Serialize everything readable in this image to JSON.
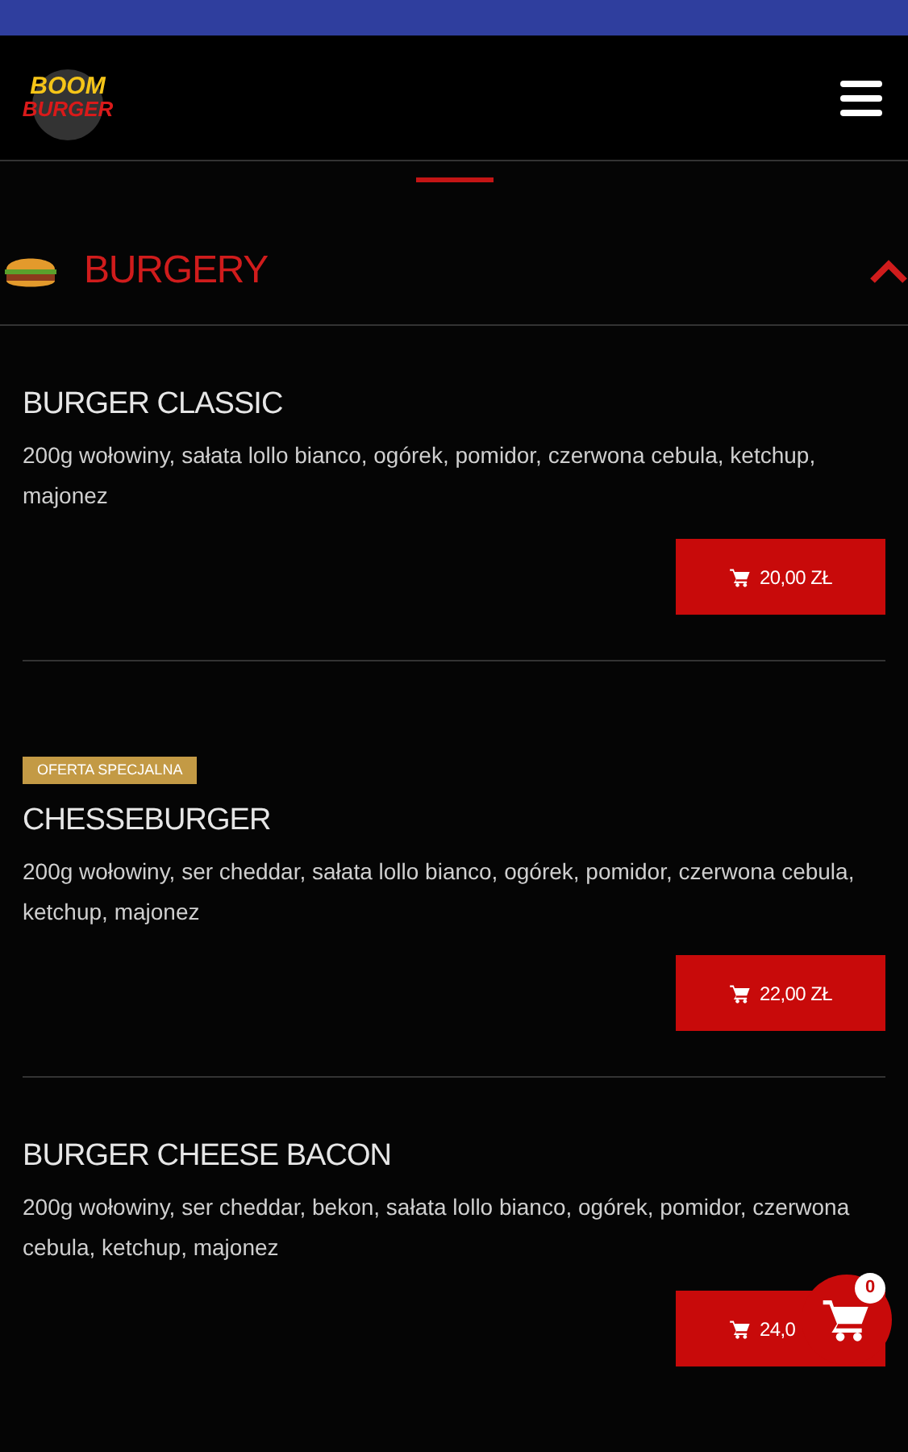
{
  "logo": {
    "line_1": "BOOM",
    "line_2": "BURGER"
  },
  "category": {
    "title": "BURGERY",
    "expanded": true
  },
  "items": [
    {
      "name": "BURGER CLASSIC",
      "description": "200g wołowiny, sałata lollo bianco, ogórek, pomidor, czerwona cebula, ketchup, majonez",
      "price": "20,00 ZŁ"
    },
    {
      "badge": "OFERTA SPECJALNA",
      "name": "CHESSEBURGER",
      "description": "200g wołowiny, ser cheddar, sałata lollo bianco, ogórek, pomidor, czerwona cebula, ketchup, majonez",
      "price": "22,00 ZŁ"
    },
    {
      "name": "BURGER CHEESE BACON",
      "description": "200g wołowiny, ser cheddar, bekon, sałata lollo bianco, ogórek, pomidor, czerwona cebula, ketchup, majonez",
      "price": "24,0"
    }
  ],
  "cart": {
    "count": "0"
  }
}
